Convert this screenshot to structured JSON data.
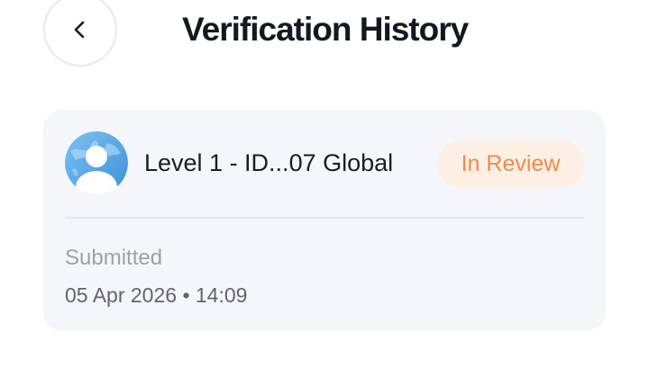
{
  "header": {
    "back_icon": "chevron-left-icon",
    "title": "Verification History"
  },
  "record": {
    "avatar_icon": "user-globe-avatar-icon",
    "name": "Level 1 - ID...07 Global",
    "status": "In Review",
    "submitted_label": "Submitted",
    "submitted_datetime": "05 Apr 2026 • 14:09"
  },
  "colors": {
    "title": "#141821",
    "card_background": "#f5f6f9",
    "status_text": "#ee8a4d",
    "status_background": "#fdefe4",
    "muted_text": "#9ba1ab"
  }
}
